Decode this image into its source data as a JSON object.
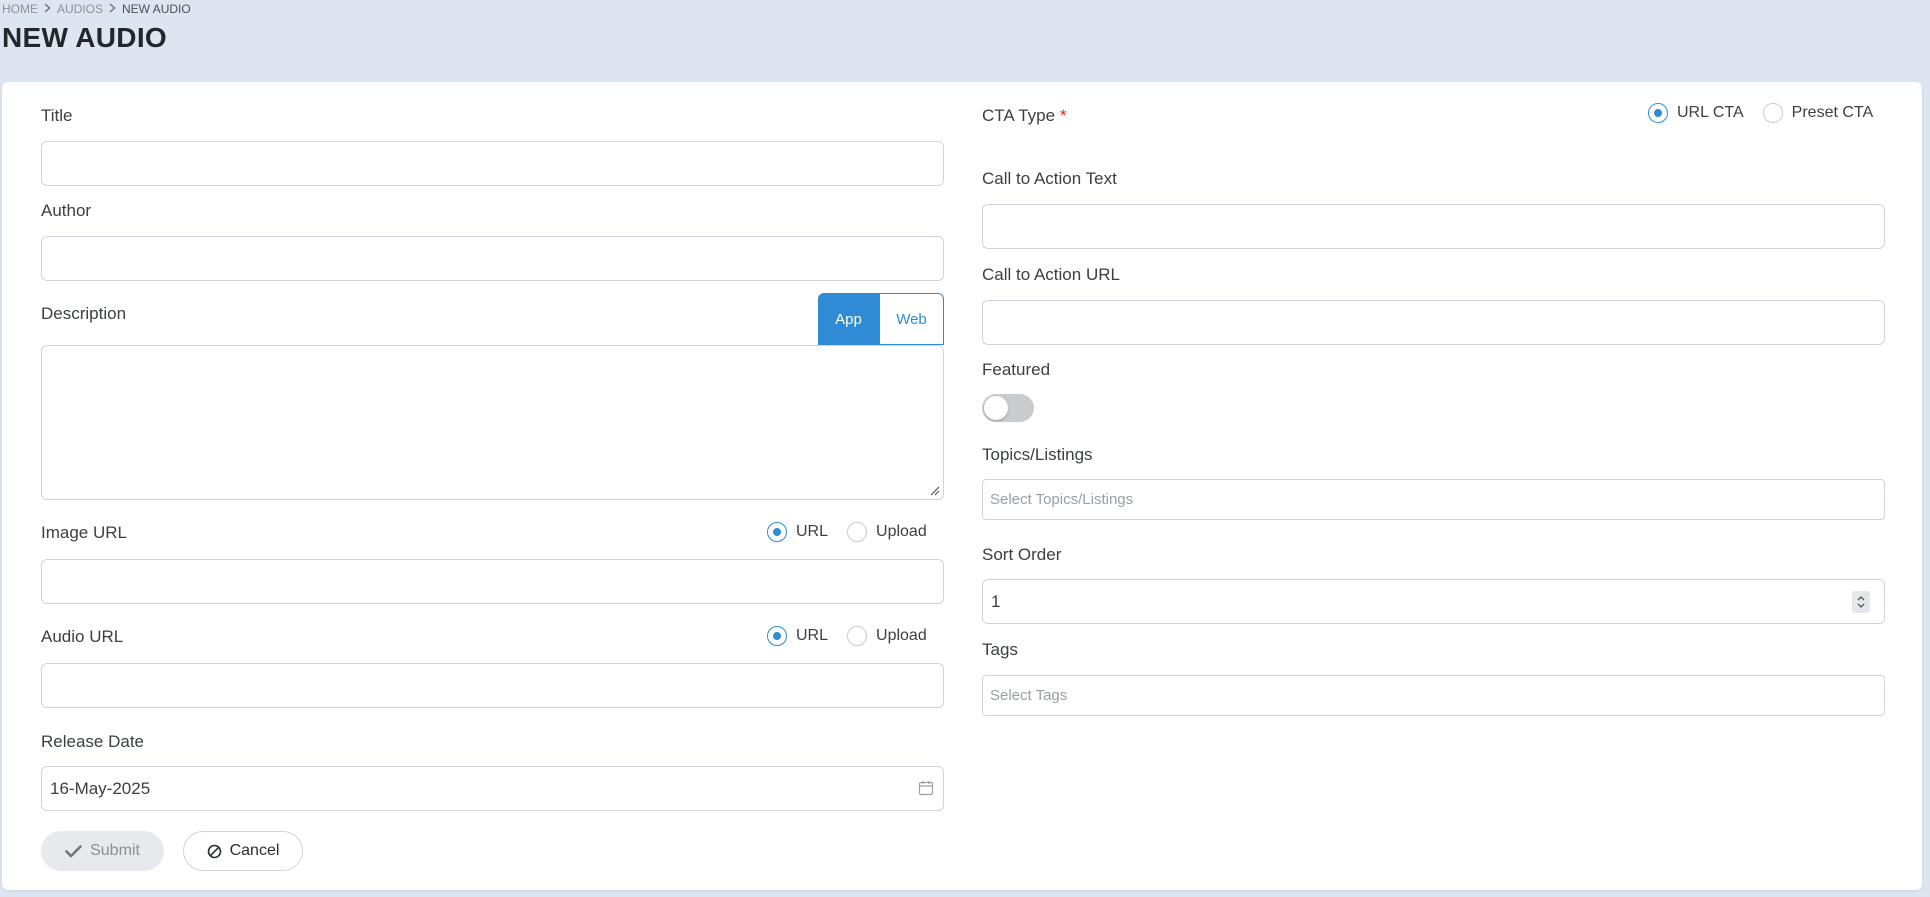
{
  "breadcrumb": {
    "items": [
      "HOME",
      "AUDIOS",
      "NEW AUDIO"
    ]
  },
  "page_title": "NEW AUDIO",
  "colors": {
    "accent": "#2f8bd6",
    "page_bg": "#dde6f0",
    "required": "#e02424"
  },
  "left": {
    "title": {
      "label": "Title",
      "value": ""
    },
    "author": {
      "label": "Author",
      "value": ""
    },
    "description": {
      "label": "Description",
      "value": "",
      "tabs": [
        {
          "label": "App",
          "active": true
        },
        {
          "label": "Web",
          "active": false
        }
      ]
    },
    "image_url": {
      "label": "Image URL",
      "value": "",
      "options": [
        {
          "label": "URL",
          "checked": true
        },
        {
          "label": "Upload",
          "checked": false
        }
      ]
    },
    "audio_url": {
      "label": "Audio URL",
      "value": "",
      "options": [
        {
          "label": "URL",
          "checked": true
        },
        {
          "label": "Upload",
          "checked": false
        }
      ]
    },
    "release_date": {
      "label": "Release Date",
      "value": "16-May-2025",
      "icon": "calendar-icon"
    }
  },
  "right": {
    "cta_type": {
      "label": "CTA Type",
      "required_marker": "*",
      "options": [
        {
          "label": "URL CTA",
          "checked": true
        },
        {
          "label": "Preset CTA",
          "checked": false
        }
      ]
    },
    "cta_text": {
      "label": "Call to Action Text",
      "value": ""
    },
    "cta_url": {
      "label": "Call to Action URL",
      "value": ""
    },
    "featured": {
      "label": "Featured",
      "on": false
    },
    "topics": {
      "label": "Topics/Listings",
      "placeholder": "Select Topics/Listings"
    },
    "sort_order": {
      "label": "Sort Order",
      "value": "1"
    },
    "tags": {
      "label": "Tags",
      "placeholder": "Select Tags"
    }
  },
  "actions": {
    "submit_label": "Submit",
    "submit_icon": "check-icon",
    "cancel_label": "Cancel",
    "cancel_icon": "ban-icon"
  }
}
